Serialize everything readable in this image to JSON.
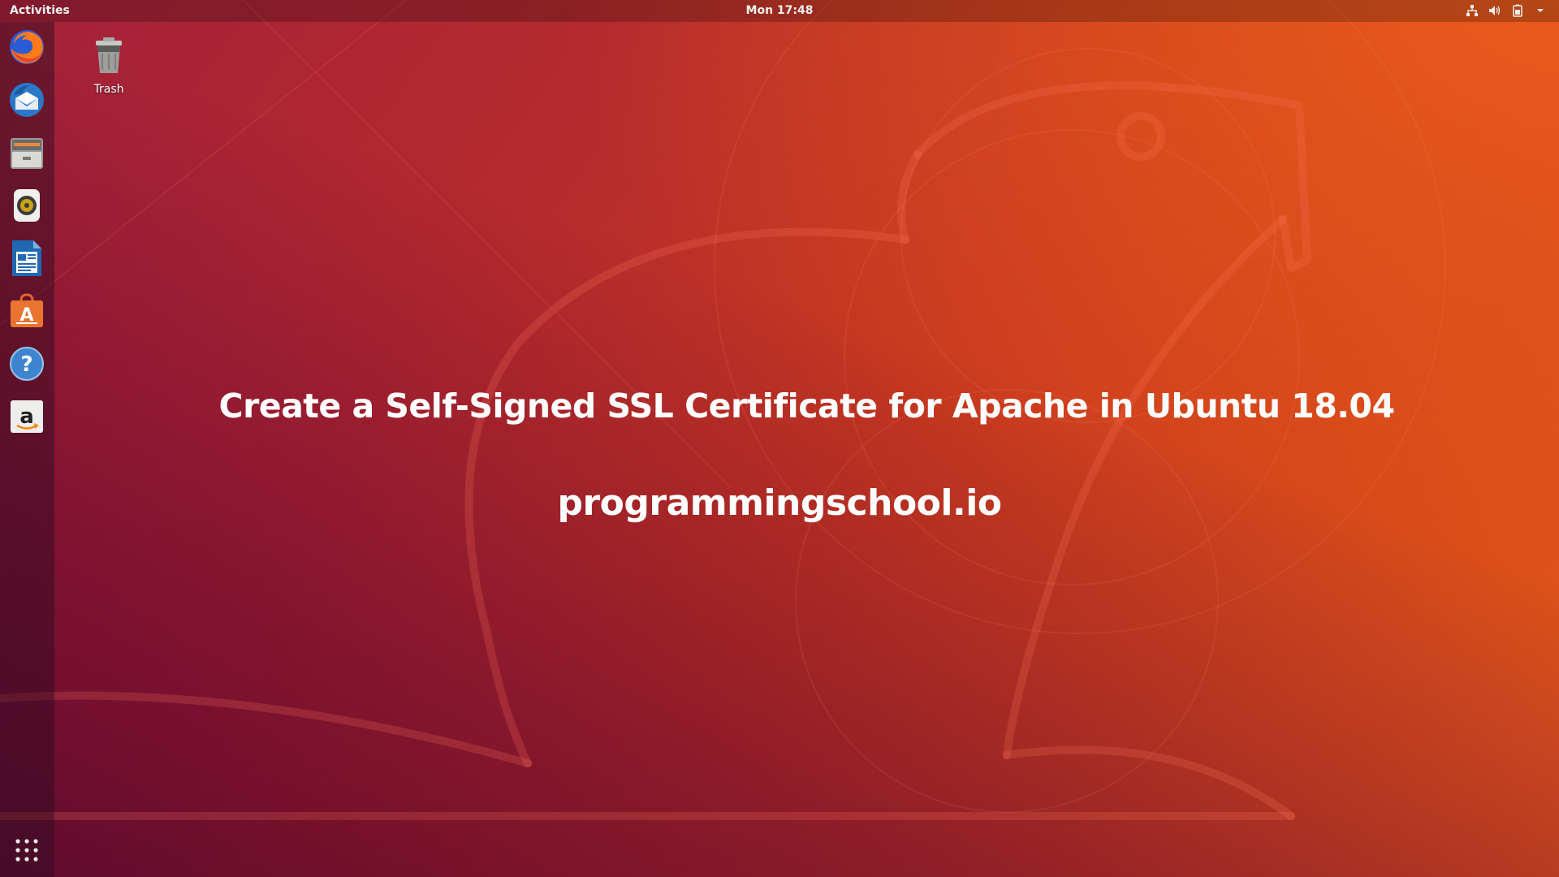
{
  "topbar": {
    "activities_label": "Activities",
    "clock": "Mon 17:48",
    "tray_icons": [
      "network-icon",
      "volume-icon",
      "battery-icon",
      "system-menu-chevron-icon"
    ]
  },
  "dock": {
    "items": [
      {
        "name": "Firefox",
        "icon": "firefox-icon"
      },
      {
        "name": "Thunderbird",
        "icon": "thunderbird-icon"
      },
      {
        "name": "Files",
        "icon": "files-icon"
      },
      {
        "name": "Rhythmbox",
        "icon": "rhythmbox-icon"
      },
      {
        "name": "LibreOffice Writer",
        "icon": "writer-icon"
      },
      {
        "name": "Ubuntu Software",
        "icon": "software-center-icon"
      },
      {
        "name": "Help",
        "icon": "help-icon"
      },
      {
        "name": "Amazon",
        "icon": "amazon-icon"
      }
    ],
    "show_apps_icon": "app-grid-icon"
  },
  "desktop": {
    "trash_label": "Trash",
    "headline": "Create a Self-Signed SSL Certificate for Apache in Ubuntu 18.04",
    "site": "programmingschool.io"
  },
  "colors": {
    "wallpaper_orange": "#e3581a",
    "wallpaper_red": "#b52a2e",
    "wallpaper_purple": "#5a0b3c",
    "text": "#ffffff"
  }
}
